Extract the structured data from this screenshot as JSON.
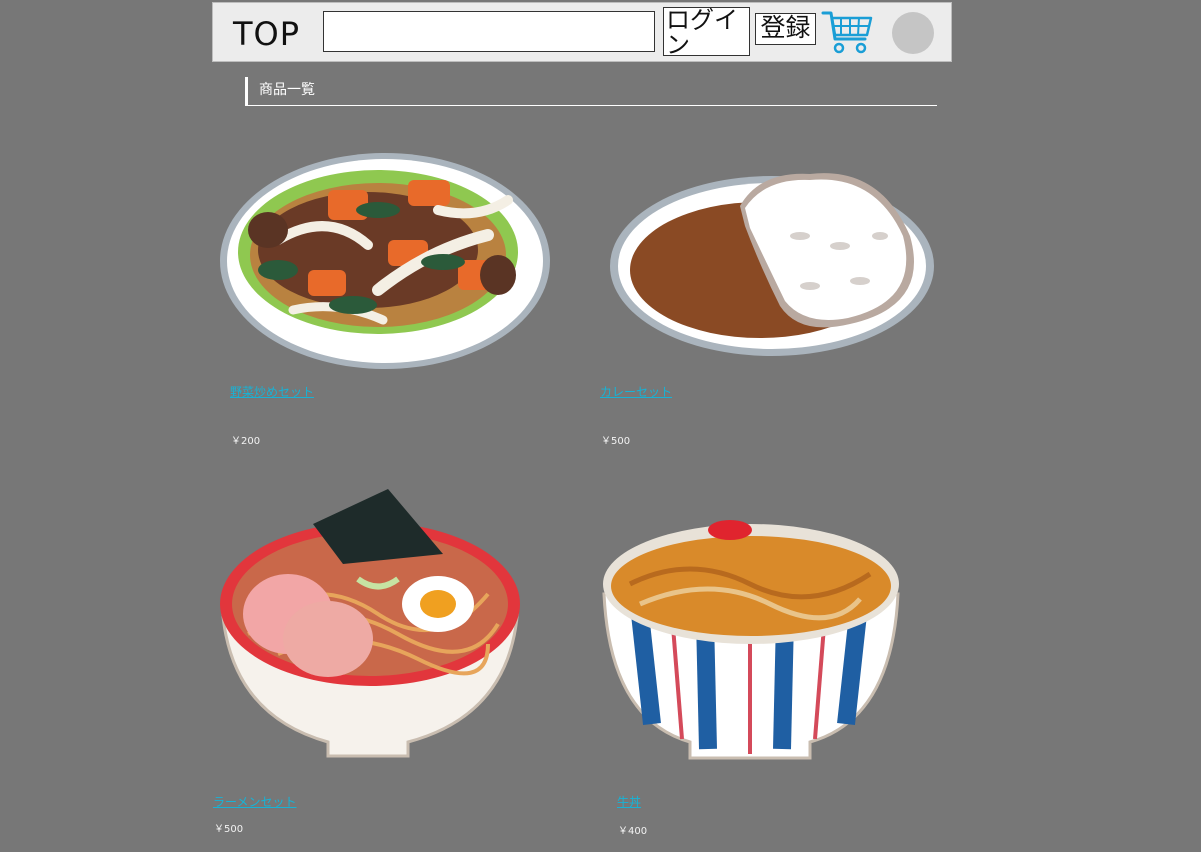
{
  "header": {
    "top_label": "TOP",
    "search_value": "",
    "login_label": "ログイン",
    "register_label": "登録"
  },
  "section": {
    "title": "商品一覧"
  },
  "products": [
    {
      "name": "野菜炒めセット",
      "price": "￥200",
      "icon": "stir-fry-vegetables-plate"
    },
    {
      "name": "カレーセット",
      "price": "￥500",
      "icon": "curry-rice-plate"
    },
    {
      "name": "ラーメンセット",
      "price": "￥500",
      "icon": "ramen-bowl"
    },
    {
      "name": "牛丼",
      "price": "￥400",
      "icon": "beef-bowl"
    }
  ],
  "colors": {
    "background": "#777777",
    "link": "#17b3d6",
    "cart": "#1a9ed6"
  }
}
